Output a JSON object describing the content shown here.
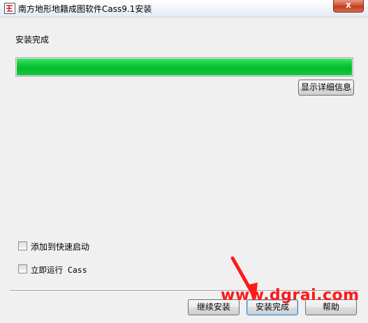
{
  "window": {
    "title": "南方地形地籍成图软件Cass9.1安装",
    "close_label": "x"
  },
  "main": {
    "status_text": "安装完成",
    "progress": 1.0,
    "progress_color": "#0fcc3a",
    "details_button_label": "显示详细信息"
  },
  "options": [
    {
      "label": "添加到快速启动",
      "checked": false
    },
    {
      "label": "立即运行 Cass",
      "checked": false
    }
  ],
  "footer": {
    "continue_label": "继续安装",
    "finish_label": "安装完成",
    "help_label": "帮助"
  },
  "overlay": {
    "watermark_text": "www.dgrai.com",
    "watermark_color": "#ff1a1a"
  }
}
